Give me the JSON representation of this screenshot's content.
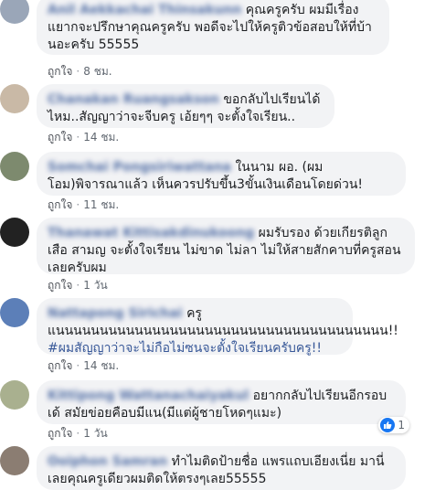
{
  "comments": [
    {
      "name": "Anil Aekkachai Thinsakunn",
      "text": "คุณครูครับ ผมมีเรื่องแยากจะปรึกษาคุณครูครับ พอดีจะไปให้ครูติวข้อสอบให้ที่บ้านอะครับ 55555",
      "like": "ถูกใจ",
      "time": "8 ชม."
    },
    {
      "name": "Chanakan Ruangsakson",
      "text": "ขอกลับไปเรียนได้ไหม..สัญญาว่าจะจีบครู เอ้ยๆๆ จะตั้งใจเรียน..",
      "like": "ถูกใจ",
      "time": "14 ชม."
    },
    {
      "name": "Somchai Pongsiriwattana",
      "text": "ในนาม ผอ. (ผมโอม)พิจารณาแล้ว เห็นควรปรับขึ้น3ขั้นเงินเดือนโดยด่วน!",
      "like": "ถูกใจ",
      "time": "11 ชม."
    },
    {
      "name": "Thanawat Kittisakdinukoong",
      "text": "ผมรับรอง ด้วยเกียรติลูกเสือ สามญ จะตั้งใจเรียน ไม่ขาด ไม่ลา ไม่ให้สายสักคาบที่ครูสอนเลยครับผม",
      "like": "ถูกใจ",
      "time": "1 วัน"
    },
    {
      "name": "Nattapong Sirichai",
      "suffix": "ครู",
      "text": "แนนนนนนนนนนนนนนนนนนนนนนนนนนนนนนนนนนนนนน!!",
      "hashtag": "#ผมสัญญาว่าจะไม่กือไม่ซนจะตั้งใจเรียนครับครู!!",
      "like": "ถูกใจ",
      "time": "14 ชม."
    },
    {
      "name": "Kittipong Wattanachaiyakul",
      "text": "อยากกลับไปเรียนอีกรอบเด้ สมัยข่อยคือบมีแน(มีแต่ผู้ชายโหดๆแมะ)",
      "like": "ถูกใจ",
      "time": "1 วัน",
      "reaction_count": "1"
    },
    {
      "name": "Ooiphon Samran",
      "text": "ทำไมติดป้ายชื่อ แพรแถบเอียงเนี่ย มานี่เลยคุณครูเดียวผมติดให้ตรงๆเลย55555",
      "like": "ถูกใจ",
      "time": ""
    }
  ],
  "colors": {
    "link": "#385898",
    "bubble": "#f2f3f5",
    "meta": "#606770",
    "like_blue": "#1877f2"
  },
  "icons": [
    "avatar",
    "thumbs-up-icon"
  ]
}
